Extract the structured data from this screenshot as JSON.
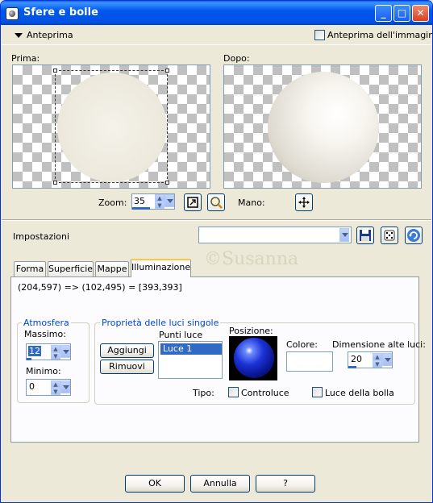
{
  "window": {
    "title": "Sfere e bolle"
  },
  "titlebar_buttons": {
    "minimize": "_",
    "maximize": "□",
    "close": "✕"
  },
  "preview": {
    "header_label": "Anteprima",
    "image_preview_checkbox_label": "Anteprima dell'immagine",
    "before_label": "Prima:",
    "after_label": "Dopo:",
    "zoom_label": "Zoom:",
    "zoom_value": "35",
    "pan_label": "Mano:"
  },
  "settings": {
    "label": "Impostazioni",
    "preset_value": ""
  },
  "tabs": [
    {
      "label": "Forma"
    },
    {
      "label": "Superficie"
    },
    {
      "label": "Mappe"
    },
    {
      "label": "Illuminazione"
    }
  ],
  "watermark": "©Susanna",
  "lighting": {
    "coords_text": "(204,597) => (102,495) = [393,393]",
    "ambient": {
      "title": "Atmosfera",
      "max_label": "Massimo:",
      "max_value": "12",
      "min_label": "Minimo:",
      "min_value": "0"
    },
    "single_lights": {
      "title": "Proprietà delle luci singole",
      "add_button": "Aggiungi",
      "remove_button": "Rimuovi",
      "points_label": "Punti luce",
      "lights": [
        "Luce 1"
      ],
      "position_label": "Posizione:",
      "color_label": "Colore:",
      "highlight_size_label": "Dimensione alte luci:",
      "highlight_size_value": "20",
      "type_label": "Tipo:",
      "backlight_label": "Controluce",
      "bubble_light_label": "Luce della bolla"
    }
  },
  "buttons": {
    "ok": "OK",
    "cancel": "Annulla",
    "help": "?"
  }
}
